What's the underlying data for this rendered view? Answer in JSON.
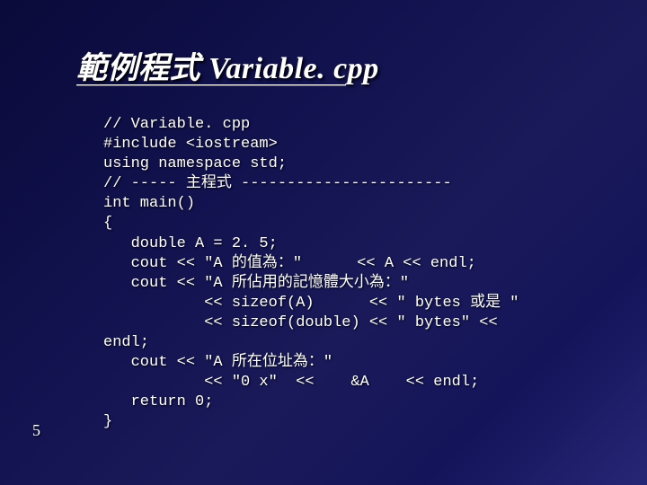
{
  "slide": {
    "title": "範例程式 Variable. cpp",
    "page_number": "5",
    "code_lines": [
      "// Variable. cpp",
      "#include <iostream>",
      "using namespace std;",
      "// ----- 主程式 -----------------------",
      "int main()",
      "{",
      "   double A = 2. 5;",
      "   cout << \"A 的值為：\"      << A << endl;",
      "   cout << \"A 所佔用的記憶體大小為：\"",
      "           << sizeof(A)      << \" bytes 或是 \"",
      "           << sizeof(double) << \" bytes\" <<",
      "endl;",
      "   cout << \"A 所在位址為：\"",
      "           << \"0 x\"  <<    &A    << endl;",
      "   return 0;",
      "}"
    ]
  }
}
